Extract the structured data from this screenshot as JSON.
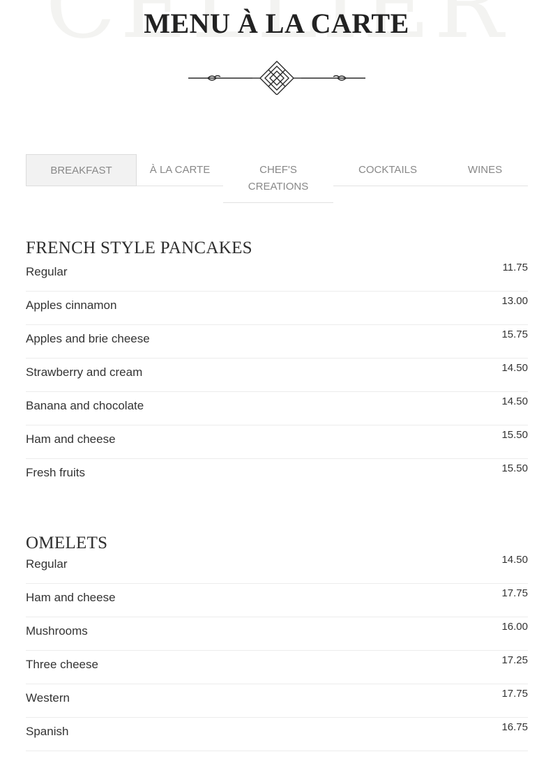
{
  "watermark_text": "CELLIER",
  "page_title": "MENU À LA CARTE",
  "ornament_icon": "decorative-knot-divider",
  "tabs": [
    {
      "label": "BREAKFAST",
      "active": true
    },
    {
      "label": "À LA CARTE",
      "active": false
    },
    {
      "label": "CHEF'S CREATIONS",
      "active": false
    },
    {
      "label": "COCKTAILS",
      "active": false
    },
    {
      "label": "WINES",
      "active": false
    }
  ],
  "sections": [
    {
      "title": "FRENCH STYLE PANCAKES",
      "items": [
        {
          "name": "Regular",
          "price": "11.75"
        },
        {
          "name": "Apples cinnamon",
          "price": "13.00"
        },
        {
          "name": "Apples and brie cheese",
          "price": "15.75"
        },
        {
          "name": "Strawberry and cream",
          "price": "14.50"
        },
        {
          "name": "Banana and chocolate",
          "price": "14.50"
        },
        {
          "name": "Ham and cheese",
          "price": "15.50"
        },
        {
          "name": "Fresh fruits",
          "price": "15.50"
        }
      ]
    },
    {
      "title": "OMELETS",
      "items": [
        {
          "name": "Regular",
          "price": "14.50"
        },
        {
          "name": "Ham and cheese",
          "price": "17.75"
        },
        {
          "name": "Mushrooms",
          "price": "16.00"
        },
        {
          "name": "Three cheese",
          "price": "17.25"
        },
        {
          "name": "Western",
          "price": "17.75"
        },
        {
          "name": "Spanish",
          "price": "16.75"
        }
      ]
    }
  ],
  "colors": {
    "background": "#ffffff",
    "title": "#222222",
    "text": "#333333",
    "tab_text": "#888888",
    "tab_active_bg": "#f2f2f2",
    "divider": "#ececec",
    "watermark": "#f3f3f1"
  }
}
